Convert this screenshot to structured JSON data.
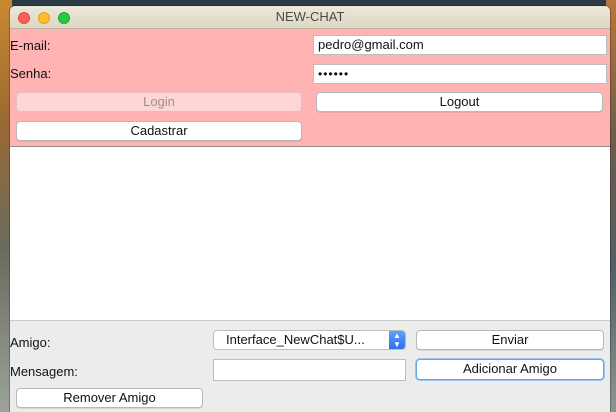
{
  "window": {
    "title": "NEW-CHAT"
  },
  "login": {
    "email_label": "E-mail:",
    "email_value": "pedro@gmail.com",
    "password_label": "Senha:",
    "password_value": "••••••",
    "login_button": "Login",
    "logout_button": "Logout",
    "register_button": "Cadastrar"
  },
  "chat": {
    "friend_label": "Amigo:",
    "friend_selected": "Interface_NewChat$U...",
    "send_button": "Enviar",
    "message_label": "Mensagem:",
    "message_value": "",
    "add_friend_button": "Adicionar Amigo",
    "remove_friend_button": "Remover Amigo"
  },
  "colors": {
    "login_panel_bg": "#ffb3b3",
    "focus_ring": "#6aa2e8",
    "select_arrow": "#2f6fe8"
  },
  "icons": {
    "select_arrows": "up-down-chevron-icon"
  }
}
